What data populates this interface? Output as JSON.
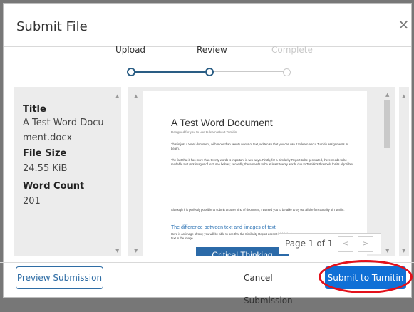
{
  "dialog": {
    "title": "Submit File",
    "close_glyph": "×"
  },
  "stepper": {
    "steps": [
      {
        "label": "Upload",
        "state": "done"
      },
      {
        "label": "Review",
        "state": "current"
      },
      {
        "label": "Complete",
        "state": "pending"
      }
    ],
    "accent": "#2a5d84"
  },
  "info": {
    "title_label": "Title",
    "title_value_1": "A Test Word Docu",
    "title_value_2": "ment.docx",
    "size_label": "File Size",
    "size_value": "24.55 KiB",
    "count_label": "Word Count",
    "count_value": "201"
  },
  "preview": {
    "doc_title": "A Test Word Document",
    "doc_subtitle": "Designed for you to use to learn about Turnitin",
    "para1": "This is just a Word document, with more than twenty words of text, written so that you can use it to learn about Turnitin assignments in Learn.",
    "para2": "The fact that it has more than twenty words is important in two ways. Firstly, for a Similarity Report to be generated, there needs to be readable text (not images of text, see below); secondly, there needs to be at least twenty words due to Turnitin's threshold for its algorithm.",
    "para3": "Although it is perfectly possible to submit another kind of document, I wanted you to be able to try out all the functionality of Turnitin.",
    "heading2": "The difference between text and 'images of text'",
    "para4": "Here is an image of text; you will be able to see that the Similarity Report doesn't highlight the text in the image.",
    "image_text": "Critical Thinking",
    "pager_label": "Page 1 of 1",
    "prev_glyph": "<",
    "next_glyph": ">"
  },
  "footer": {
    "preview_btn": "Preview Submission",
    "cancel_btn": "Cancel Submission",
    "submit_btn": "Submit to Turnitin",
    "submit_color": "#1070d6",
    "highlight_color": "#e3111b"
  }
}
